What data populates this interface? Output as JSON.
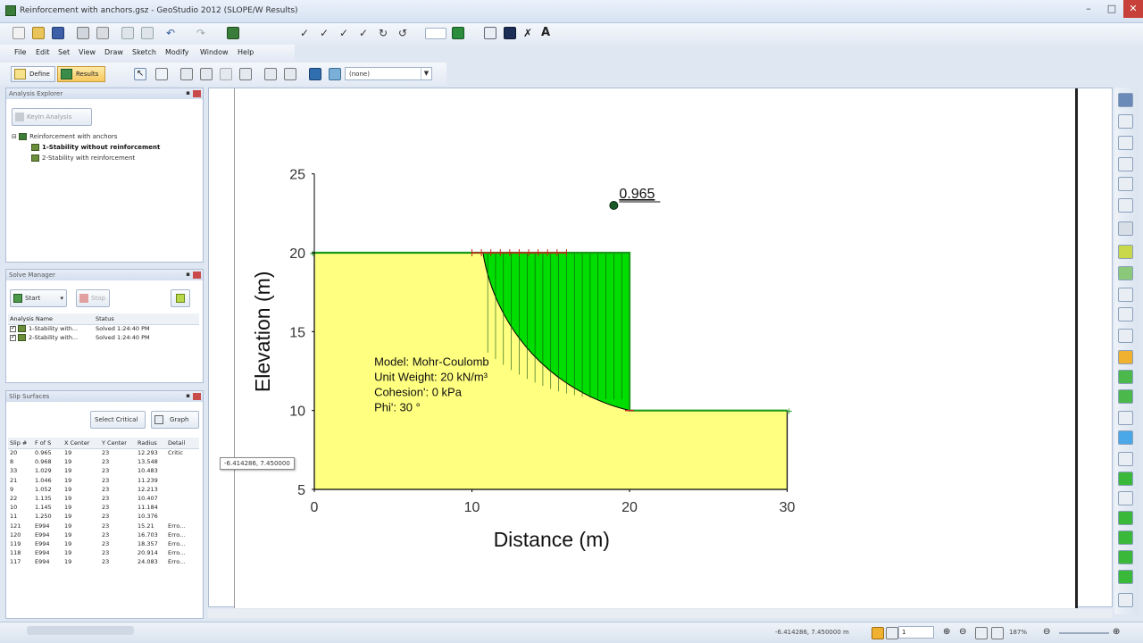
{
  "window": {
    "title": "Reinforcement with anchors.gsz - GeoStudio 2012 (SLOPE/W Results)"
  },
  "menu": [
    "File",
    "Edit",
    "Set",
    "View",
    "Draw",
    "Sketch",
    "Modify",
    "Window",
    "Help"
  ],
  "modes": {
    "define": "Define",
    "results": "Results"
  },
  "view_combo": "(none)",
  "analysis_explorer": {
    "title": "Analysis Explorer",
    "keyin_button": "KeyIn Analysis",
    "root": "Reinforcement with anchors",
    "items": [
      "1-Stability without reinforcement",
      "2-Stability with reinforcement"
    ]
  },
  "solve_manager": {
    "title": "Solve Manager",
    "start_button": "Start",
    "stop_button": "Stop",
    "columns": [
      "Analysis Name",
      "Status"
    ],
    "rows": [
      [
        "1-Stability with...",
        "Solved 1:24:40 PM"
      ],
      [
        "2-Stability with...",
        "Solved 1:24:40 PM"
      ]
    ]
  },
  "slip_surfaces": {
    "title": "Slip Surfaces",
    "select_critical_button": "Select Critical",
    "graph_button": "Graph",
    "columns": [
      "Slip #",
      "F of S",
      "X Center",
      "Y Center",
      "Radius",
      "Detail"
    ],
    "rows": [
      [
        "20",
        "0.965",
        "19",
        "23",
        "12.293",
        "Critic"
      ],
      [
        "8",
        "0.968",
        "19",
        "23",
        "13.548",
        ""
      ],
      [
        "33",
        "1.029",
        "19",
        "23",
        "10.483",
        ""
      ],
      [
        "21",
        "1.046",
        "19",
        "23",
        "11.239",
        ""
      ],
      [
        "9",
        "1.052",
        "19",
        "23",
        "12.213",
        ""
      ],
      [
        "22",
        "1.135",
        "19",
        "23",
        "10.407",
        ""
      ],
      [
        "10",
        "1.145",
        "19",
        "23",
        "11.184",
        ""
      ],
      [
        "11",
        "1.250",
        "19",
        "23",
        "10.376",
        ""
      ],
      [
        "121",
        "E994",
        "19",
        "23",
        "15.21",
        "Erro..."
      ],
      [
        "120",
        "E994",
        "19",
        "23",
        "16.703",
        "Erro..."
      ],
      [
        "119",
        "E994",
        "19",
        "23",
        "18.357",
        "Erro..."
      ],
      [
        "118",
        "E994",
        "19",
        "23",
        "20.914",
        "Erro..."
      ],
      [
        "117",
        "E994",
        "19",
        "23",
        "24.083",
        "Erro..."
      ]
    ]
  },
  "tooltip": "-6.414286, 7.450000",
  "status": {
    "coords": "-6.414286, 7.450000 m",
    "page": "1",
    "zoom": "187%"
  },
  "chart_data": {
    "type": "diagram",
    "xlabel": "Distance (m)",
    "ylabel": "Elevation (m)",
    "xlim": [
      0,
      30
    ],
    "ylim": [
      5,
      25
    ],
    "x_ticks": [
      0,
      10,
      20,
      30
    ],
    "y_ticks": [
      5,
      10,
      15,
      20,
      25
    ],
    "slope_region": [
      [
        0,
        5
      ],
      [
        0,
        20
      ],
      [
        20,
        20
      ],
      [
        20,
        10
      ],
      [
        30,
        10
      ],
      [
        30,
        5
      ]
    ],
    "slip_center": [
      19,
      23
    ],
    "slip_radius": 12.293,
    "factor_of_safety": "0.965",
    "slip_entry_exit": [
      [
        10.7,
        20
      ],
      [
        20,
        10
      ]
    ],
    "reinforcement_line": [
      [
        10,
        20
      ],
      [
        16,
        20
      ]
    ],
    "material": {
      "lines": [
        "Model: Mohr-Coulomb",
        "Unit Weight: 20 kN/m³",
        "Cohesion': 0 kPa",
        "Phi': 30 °"
      ],
      "fill": "#ffff80"
    },
    "slip_fill": "#00dd00",
    "ground_line_color": "#1a9a1a"
  }
}
